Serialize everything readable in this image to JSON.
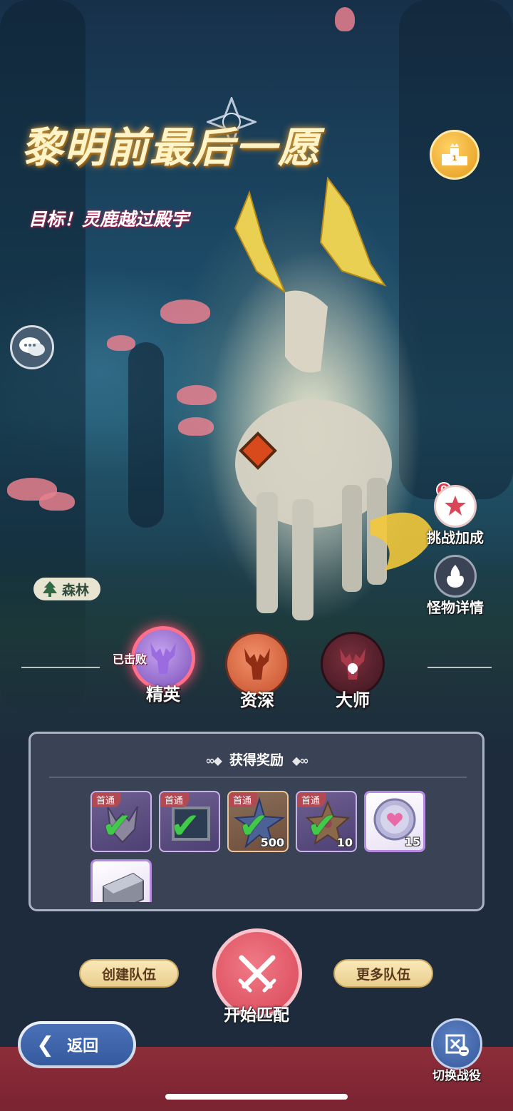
{
  "header": {
    "title": "黎明前最后一愿",
    "objective": "目标！灵鹿越过殿宇"
  },
  "side_buttons": {
    "challenge_bonus": {
      "label": "挑战加成",
      "badge": "0"
    },
    "monster_details": {
      "label": "怪物详情"
    }
  },
  "location": {
    "label": "森林"
  },
  "difficulty": {
    "defeated_label": "已击败",
    "levels": [
      {
        "label": "精英",
        "state": "selected-defeated"
      },
      {
        "label": "资深",
        "state": "available"
      },
      {
        "label": "大师",
        "state": "locked"
      }
    ]
  },
  "rewards_panel": {
    "title": "获得奖励",
    "items": [
      {
        "icon": "antler-mark-icon",
        "tag": "首通",
        "claimed": true,
        "quantity": "",
        "rarity": "purple"
      },
      {
        "icon": "picture-frame-icon",
        "tag": "首通",
        "claimed": true,
        "quantity": "",
        "rarity": "purple"
      },
      {
        "icon": "blue-star-crystal-icon",
        "tag": "首通",
        "claimed": true,
        "quantity": "500",
        "rarity": "orange"
      },
      {
        "icon": "star-cookie-icon",
        "tag": "首通",
        "claimed": true,
        "quantity": "10",
        "rarity": "purple"
      },
      {
        "icon": "silver-heart-coin-icon",
        "tag": "",
        "claimed": false,
        "quantity": "15",
        "rarity": "white"
      },
      {
        "icon": "silver-ingot-icon",
        "tag": "",
        "claimed": false,
        "quantity": "",
        "rarity": "white"
      }
    ]
  },
  "actions": {
    "create_team": "创建队伍",
    "more_teams": "更多队伍",
    "start_match": "开始匹配",
    "back": "返回",
    "switch_campaign": "切换战役"
  },
  "colors": {
    "accent_red": "#d94658",
    "button_gold": "#e9cf8e",
    "panel_bg": "#3a4255",
    "check_green": "#41c94a"
  }
}
